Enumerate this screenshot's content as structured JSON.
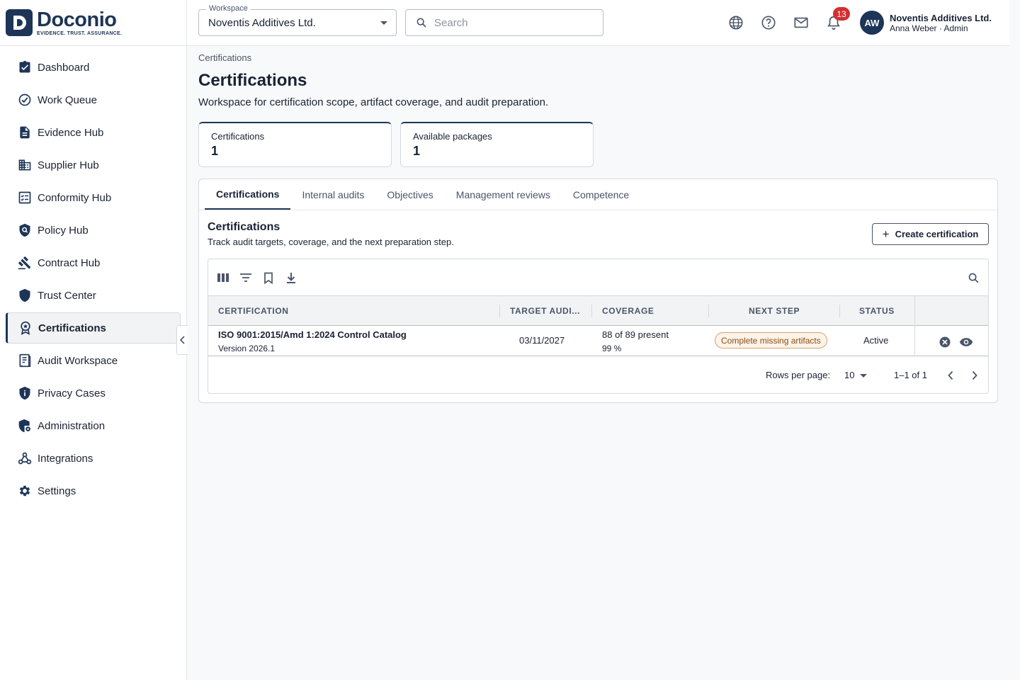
{
  "brand": {
    "name": "Doconio",
    "tagline": "EVIDENCE. TRUST. ASSURANCE.",
    "mark_letter": "D",
    "color": "#1d3557"
  },
  "sidebar": {
    "items": [
      {
        "label": "Dashboard",
        "icon": "clipboard-check-icon"
      },
      {
        "label": "Work Queue",
        "icon": "check-circle-icon"
      },
      {
        "label": "Evidence Hub",
        "icon": "document-icon"
      },
      {
        "label": "Supplier Hub",
        "icon": "building-icon"
      },
      {
        "label": "Conformity Hub",
        "icon": "checklist-icon"
      },
      {
        "label": "Policy Hub",
        "icon": "shield-search-icon"
      },
      {
        "label": "Contract Hub",
        "icon": "gavel-icon"
      },
      {
        "label": "Trust Center",
        "icon": "shield-icon"
      },
      {
        "label": "Certifications",
        "icon": "award-icon",
        "active": true
      },
      {
        "label": "Audit Workspace",
        "icon": "audit-book-icon"
      },
      {
        "label": "Privacy Cases",
        "icon": "privacy-shield-icon"
      },
      {
        "label": "Administration",
        "icon": "admin-shield-icon"
      },
      {
        "label": "Integrations",
        "icon": "webhook-icon"
      },
      {
        "label": "Settings",
        "icon": "gear-icon"
      }
    ]
  },
  "topbar": {
    "workspace_label": "Workspace",
    "workspace_value": "Noventis Additives Ltd.",
    "search_placeholder": "Search",
    "notification_count": "13",
    "avatar_initials": "AW",
    "user_org": "Noventis Additives Ltd.",
    "user_role": "Anna Weber · Admin"
  },
  "page": {
    "breadcrumb": "Certifications",
    "title": "Certifications",
    "subtitle": "Workspace for certification scope, artifact coverage, and audit preparation."
  },
  "stats": [
    {
      "label": "Certifications",
      "value": "1"
    },
    {
      "label": "Available packages",
      "value": "1"
    }
  ],
  "tabs": [
    "Certifications",
    "Internal audits",
    "Objectives",
    "Management reviews",
    "Competence"
  ],
  "section": {
    "title": "Certifications",
    "subtitle": "Track audit targets, coverage, and the next preparation step.",
    "create_label": "Create certification"
  },
  "table": {
    "columns": [
      "CERTIFICATION",
      "TARGET AUDI...",
      "COVERAGE",
      "NEXT STEP",
      "STATUS"
    ],
    "rows": [
      {
        "name": "ISO 9001:2015/Amd 1:2024 Control Catalog",
        "version": "Version 2026.1",
        "target_audit": "03/11/2027",
        "coverage": "88 of 89 present",
        "coverage_pct": "99 %",
        "next_step": "Complete missing artifacts",
        "status": "Active"
      }
    ]
  },
  "pagination": {
    "rows_per_page_label": "Rows per page:",
    "rows_per_page": "10",
    "range": "1–1 of 1"
  }
}
